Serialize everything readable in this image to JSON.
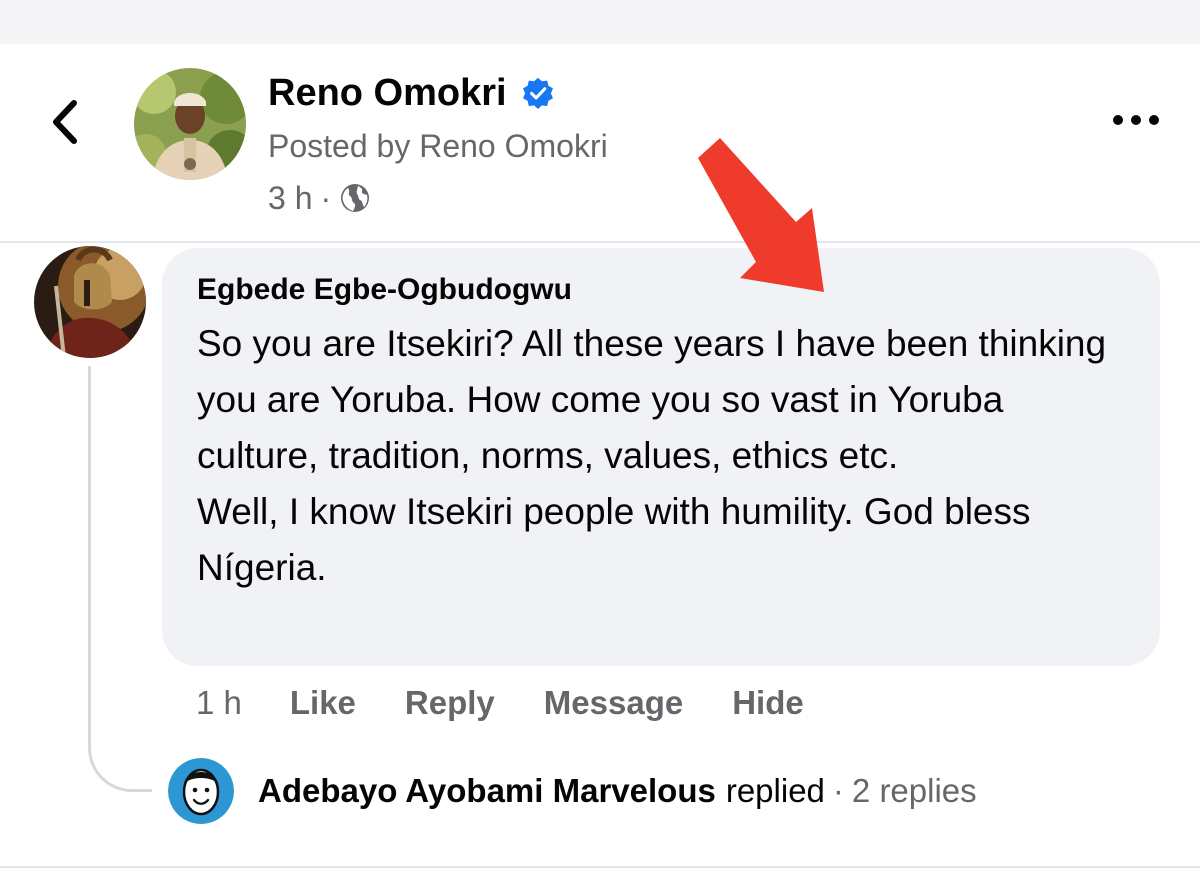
{
  "post": {
    "author": "Reno Omokri",
    "posted_by": "Posted by Reno Omokri",
    "time": "3 h",
    "separator": "·",
    "audience_icon": "globe-icon",
    "verified_icon": "verified-badge-icon"
  },
  "comment": {
    "author": "Egbede Egbe-Ogbudogwu",
    "paragraphs": [
      "So you are Itsekiri? All these years I have been thinking you are Yoruba. How come you so vast in Yoruba culture, tradition, norms, values, ethics etc.",
      "Well, I know Itsekiri people with humility. God bless Nígeria."
    ],
    "time": "1 h",
    "actions": {
      "like": "Like",
      "reply": "Reply",
      "message": "Message",
      "hide": "Hide"
    }
  },
  "reply_summary": {
    "name": "Adebayo Ayobami Marvelous",
    "verb": "replied",
    "separator": "·",
    "count": "2 replies"
  },
  "colors": {
    "accent_blue": "#1877f2",
    "secondary_text": "#65676b",
    "bubble_bg": "#f0f2f5",
    "annotation_red": "#ef3b2c"
  }
}
